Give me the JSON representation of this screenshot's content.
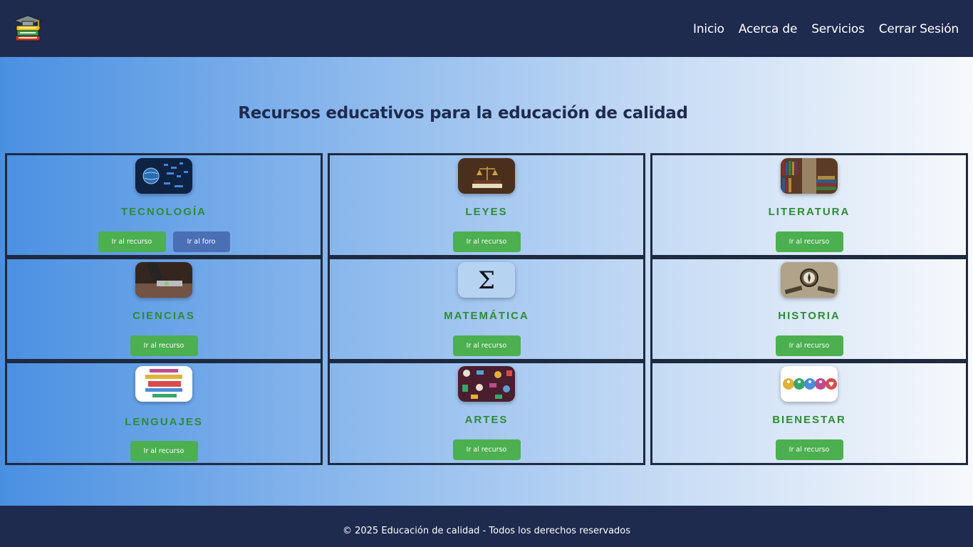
{
  "nav": {
    "items": [
      "Inicio",
      "Acerca de",
      "Servicios",
      "Cerrar Sesión"
    ]
  },
  "main": {
    "title": "Recursos educativos para la educación de calidad"
  },
  "cards": [
    {
      "title": "TECNOLOGÍA",
      "icon": "technology-globe-image",
      "buttons": [
        "Ir al recurso",
        "Ir al foro"
      ]
    },
    {
      "title": "LEYES",
      "icon": "law-scales-image",
      "buttons": [
        "Ir al recurso"
      ]
    },
    {
      "title": "LITERATURA",
      "icon": "bookshelf-image",
      "buttons": [
        "Ir al recurso"
      ]
    },
    {
      "title": "CIENCIAS",
      "icon": "microscope-image",
      "buttons": [
        "Ir al recurso"
      ]
    },
    {
      "title": "MATEMÁTICA",
      "icon": "sigma-image",
      "buttons": [
        "Ir al recurso"
      ]
    },
    {
      "title": "HISTORIA",
      "icon": "compass-map-image",
      "buttons": [
        "Ir al recurso"
      ]
    },
    {
      "title": "LENGUAJES",
      "icon": "language-word-cloud-image",
      "buttons": [
        "Ir al recurso"
      ]
    },
    {
      "title": "ARTES",
      "icon": "arts-pattern-image",
      "buttons": [
        "Ir al recurso"
      ]
    },
    {
      "title": "BIENESTAR",
      "icon": "wellbeing-icons-image",
      "buttons": [
        "Ir al recurso"
      ]
    }
  ],
  "footer": {
    "text": "© 2025 Educación de calidad - Todos los derechos reservados"
  },
  "colors": {
    "header_bg": "#1e2a4e",
    "card_title": "#2e8b35",
    "button_green": "#4caf50",
    "button_blue": "#4a6fb5"
  }
}
